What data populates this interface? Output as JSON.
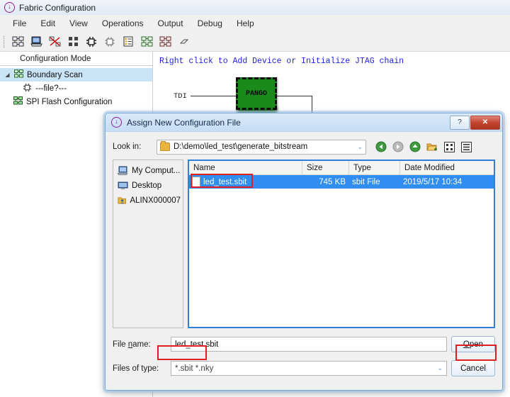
{
  "window": {
    "title": "Fabric Configuration",
    "title_icon": "download-circle-icon",
    "menu": [
      "File",
      "Edit",
      "View",
      "Operations",
      "Output",
      "Debug",
      "Help"
    ],
    "toolbar_icons": [
      "boundary-scan-icon",
      "computer-icon",
      "stop-scan-icon",
      "grid-icon",
      "chip-icon",
      "chip-outline-icon",
      "list-icon",
      "chain-add-icon",
      "chain-remove-icon",
      "eraser-icon"
    ]
  },
  "left_panel": {
    "header": "Configuration Mode",
    "tree": [
      {
        "label": "Boundary Scan",
        "icon": "chain-icon",
        "selected": true,
        "expanded": true,
        "indent": 0
      },
      {
        "label": "---file?---",
        "icon": "chip-icon",
        "selected": false,
        "indent": 1
      },
      {
        "label": "SPI Flash Configuration",
        "icon": "chain-green-icon",
        "selected": false,
        "indent": 0
      }
    ]
  },
  "workspace": {
    "hint": "Right click to Add Device or Initialize JTAG chain",
    "tdi_label": "TDI",
    "chip_label": "PANGO",
    "chip_color": "#1a8a1a"
  },
  "dialog": {
    "title": "Assign New Configuration File",
    "title_icon": "download-circle-icon",
    "help_button": "?",
    "close_button": "✕",
    "lookin": {
      "label": "Look in:",
      "path": "D:\\demo\\led_test\\generate_bitstream",
      "folder_icon": "folder-icon",
      "caret": "⌄",
      "nav": [
        "back-icon",
        "forward-icon",
        "up-icon",
        "new-folder-icon",
        "grid-view-icon",
        "detail-view-icon"
      ]
    },
    "places": [
      {
        "label": "My Comput...",
        "icon": "my-computer-icon"
      },
      {
        "label": "Desktop",
        "icon": "desktop-icon"
      },
      {
        "label": "ALINX000007",
        "icon": "user-folder-icon"
      }
    ],
    "file_list": {
      "columns": [
        "Name",
        "Size",
        "Type",
        "Date Modified"
      ],
      "rows": [
        {
          "name": "led_test.sbit",
          "size": "745 KB",
          "type": "sbit File",
          "date": "2019/5/17 10:34",
          "selected": true,
          "icon": "file-icon"
        }
      ]
    },
    "file_name": {
      "label_pre": "File ",
      "label_u": "n",
      "label_post": "ame:",
      "value": "led_test.sbit"
    },
    "files_of_type": {
      "label": "Files of type:",
      "value": "*.sbit *.nky",
      "caret": "⌄"
    },
    "buttons": {
      "open_pre": "",
      "open_u": "O",
      "open_post": "pen",
      "cancel": "Cancel"
    }
  },
  "annotations": {
    "highlight_color": "#e02020",
    "boxes": [
      "selected-file-name",
      "file-name-input",
      "open-button"
    ]
  }
}
